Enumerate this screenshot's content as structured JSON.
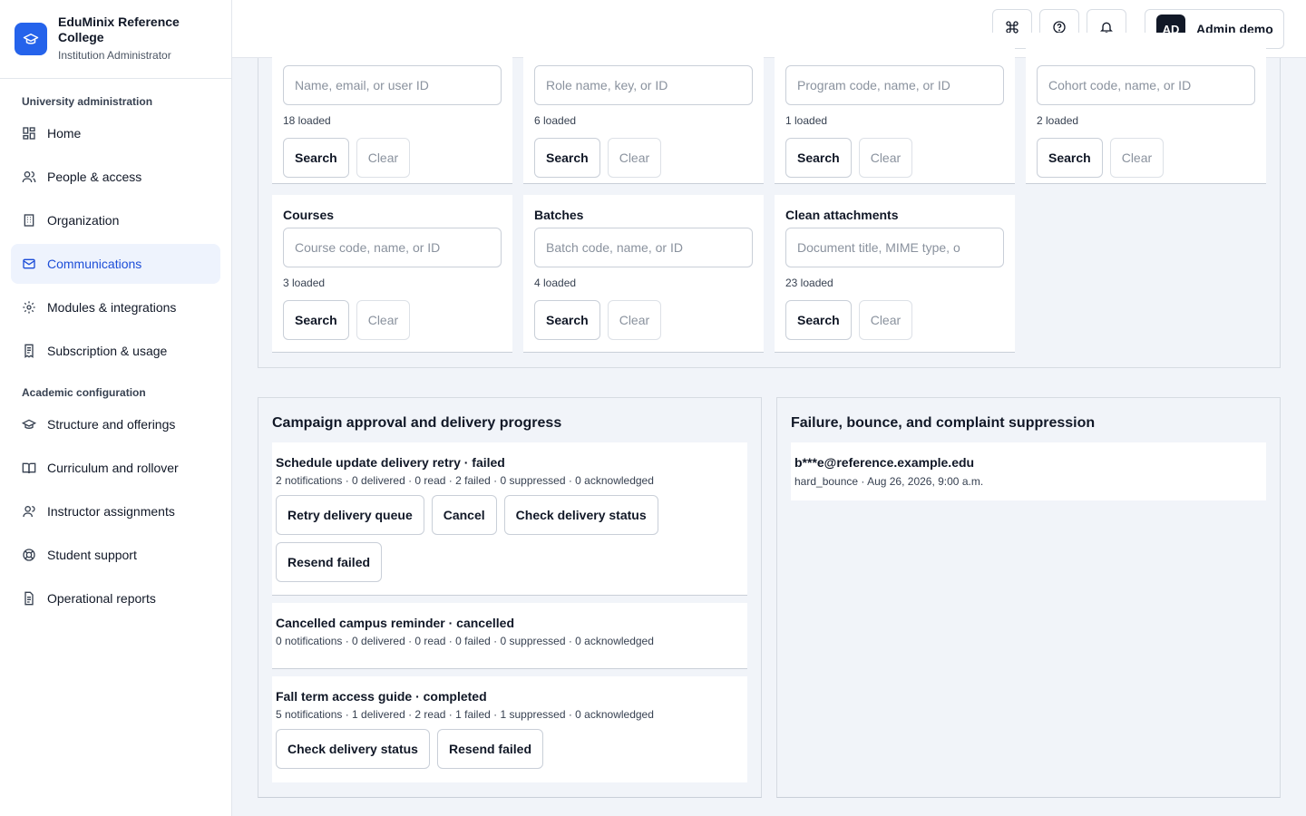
{
  "brand": {
    "name": "EduMinix Reference College",
    "role": "Institution Administrator"
  },
  "nav": {
    "section1": "University administration",
    "items1": [
      {
        "label": "Home",
        "icon": "home-icon"
      },
      {
        "label": "People & access",
        "icon": "people-icon"
      },
      {
        "label": "Organization",
        "icon": "building-icon"
      },
      {
        "label": "Communications",
        "icon": "mail-icon",
        "active": true
      },
      {
        "label": "Modules & integrations",
        "icon": "gear-icon"
      },
      {
        "label": "Subscription & usage",
        "icon": "receipt-icon"
      }
    ],
    "section2": "Academic configuration",
    "items2": [
      {
        "label": "Structure and offerings",
        "icon": "graduation-cap-icon"
      },
      {
        "label": "Curriculum and rollover",
        "icon": "book-icon"
      },
      {
        "label": "Instructor assignments",
        "icon": "person-icon"
      },
      {
        "label": "Student support",
        "icon": "lifebuoy-icon"
      },
      {
        "label": "Operational reports",
        "icon": "document-icon"
      }
    ]
  },
  "topbar": {
    "user_initials": "AD",
    "user_name": "Admin demo"
  },
  "filters": [
    {
      "title": "",
      "placeholder": "Name, email, or user ID",
      "count": "18 loaded",
      "search": "Search",
      "clear": "Clear"
    },
    {
      "title": "",
      "placeholder": "Role name, key, or ID",
      "count": "6 loaded",
      "search": "Search",
      "clear": "Clear"
    },
    {
      "title": "",
      "placeholder": "Program code, name, or ID",
      "count": "1 loaded",
      "search": "Search",
      "clear": "Clear"
    },
    {
      "title": "",
      "placeholder": "Cohort code, name, or ID",
      "count": "2 loaded",
      "search": "Search",
      "clear": "Clear"
    },
    {
      "title": "Courses",
      "placeholder": "Course code, name, or ID",
      "count": "3 loaded",
      "search": "Search",
      "clear": "Clear"
    },
    {
      "title": "Batches",
      "placeholder": "Batch code, name, or ID",
      "count": "4 loaded",
      "search": "Search",
      "clear": "Clear"
    },
    {
      "title": "Clean attachments",
      "placeholder": "Document title, MIME type, o",
      "count": "23 loaded",
      "search": "Search",
      "clear": "Clear"
    }
  ],
  "campaigns": {
    "title": "Campaign approval and delivery progress",
    "items": [
      {
        "title": "Schedule update delivery retry · failed",
        "stats": "2 notifications · 0 delivered · 0 read · 2 failed · 0 suppressed · 0 acknowledged",
        "actions": [
          "Retry delivery queue",
          "Cancel",
          "Check delivery status",
          "Resend failed"
        ]
      },
      {
        "title": "Cancelled campus reminder · cancelled",
        "stats": "0 notifications · 0 delivered · 0 read · 0 failed · 0 suppressed · 0 acknowledged",
        "actions": []
      },
      {
        "title": "Fall term access guide · completed",
        "stats": "5 notifications · 1 delivered · 2 read · 1 failed · 1 suppressed · 0 acknowledged",
        "actions": [
          "Check delivery status",
          "Resend failed"
        ]
      }
    ]
  },
  "suppression": {
    "title": "Failure, bounce, and complaint suppression",
    "items": [
      {
        "email": "b***e@reference.example.edu",
        "meta": "hard_bounce · Aug 26, 2026, 9:00 a.m."
      }
    ]
  }
}
